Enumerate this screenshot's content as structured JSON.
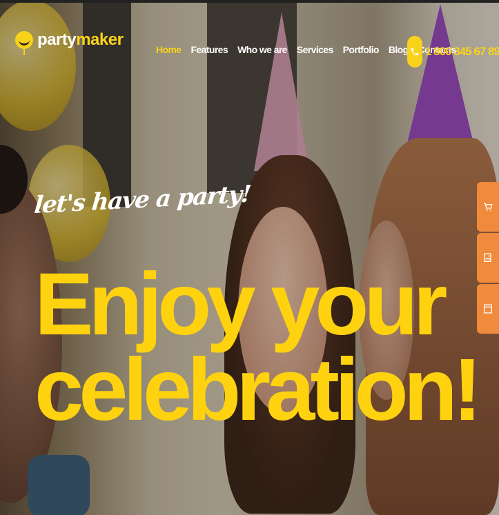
{
  "brand": {
    "part1": "party",
    "part2": "maker",
    "logo_icon": "smiley-balloon-icon",
    "accent": "#f8d21b"
  },
  "nav": {
    "items": [
      {
        "label": "Home",
        "active": true
      },
      {
        "label": "Features",
        "active": false
      },
      {
        "label": "Who we are",
        "active": false
      },
      {
        "label": "Services",
        "active": false
      },
      {
        "label": "Portfolio",
        "active": false
      },
      {
        "label": "Blog",
        "active": false
      },
      {
        "label": "Contacts",
        "active": false
      }
    ]
  },
  "phone": {
    "icon": "phone-icon",
    "number": "1 800 345 67 89"
  },
  "hero": {
    "tagline": "let's have a party!",
    "headline_line1": "Enjoy your",
    "headline_line2": "celebration!",
    "headline_color": "#ffd20f"
  },
  "side_panel": {
    "color": "#f08a3c",
    "items": [
      {
        "icon": "cart-icon"
      },
      {
        "icon": "image-gallery-icon"
      },
      {
        "icon": "layout-icon"
      }
    ]
  }
}
